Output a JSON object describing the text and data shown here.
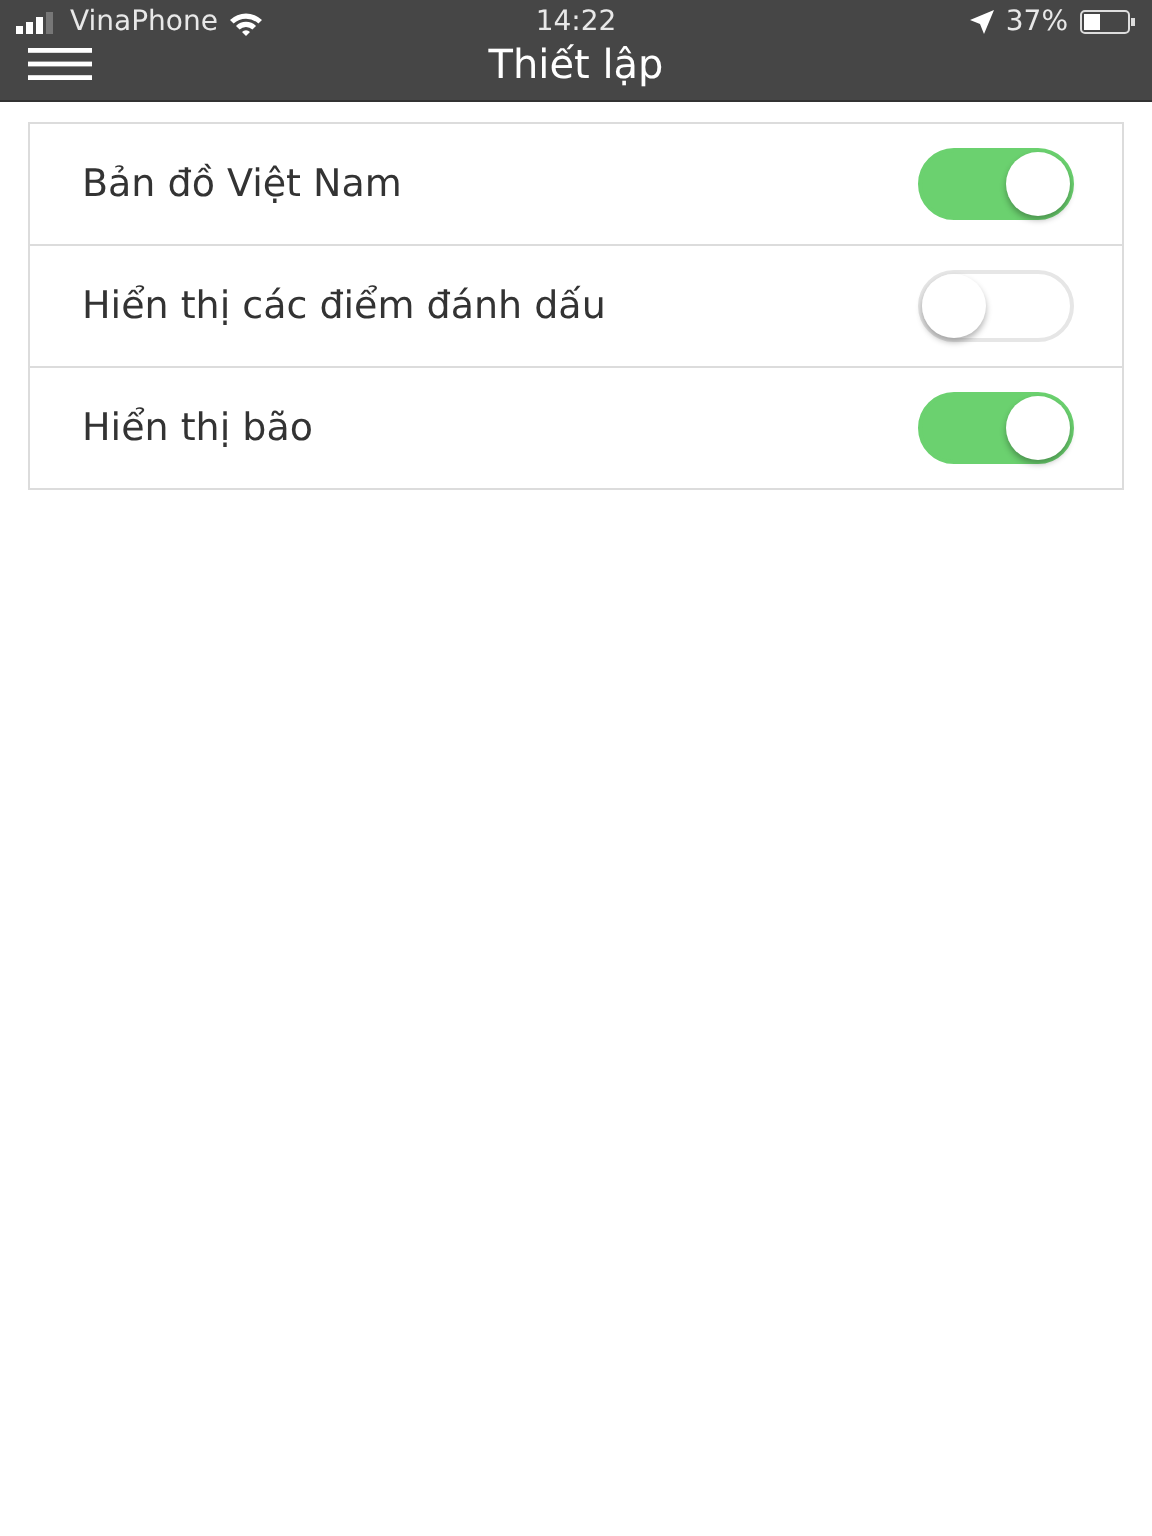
{
  "status_bar": {
    "carrier": "VinaPhone",
    "time": "14:22",
    "battery": "37%"
  },
  "header": {
    "title": "Thiết lập"
  },
  "settings": [
    {
      "label": "Bản đồ Việt Nam",
      "on": true
    },
    {
      "label": "Hiển thị các điểm đánh dấu",
      "on": false
    },
    {
      "label": "Hiển thị bão",
      "on": true
    }
  ]
}
